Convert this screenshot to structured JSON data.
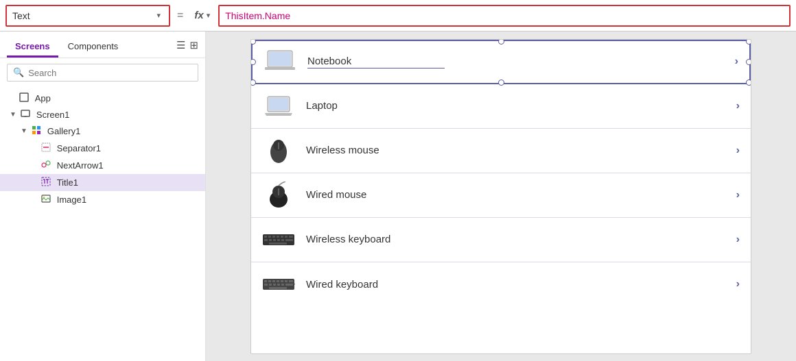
{
  "formulaBar": {
    "propertyLabel": "Text",
    "equalsSign": "=",
    "fxLabel": "fx",
    "expression": "ThisItem.Name",
    "expressionColored": "ThisItem.Name",
    "dropdownArrow": "▾",
    "dropdownArrow2": "▾"
  },
  "leftPanel": {
    "tabs": [
      {
        "id": "screens",
        "label": "Screens",
        "active": true
      },
      {
        "id": "components",
        "label": "Components",
        "active": false
      }
    ],
    "searchPlaceholder": "Search",
    "tree": [
      {
        "id": "app",
        "label": "App",
        "level": 0,
        "icon": "app",
        "expandable": false,
        "selected": false
      },
      {
        "id": "screen1",
        "label": "Screen1",
        "level": 0,
        "icon": "screen",
        "expandable": true,
        "expanded": true,
        "selected": false
      },
      {
        "id": "gallery1",
        "label": "Gallery1",
        "level": 1,
        "icon": "gallery",
        "expandable": true,
        "expanded": true,
        "selected": false
      },
      {
        "id": "separator1",
        "label": "Separator1",
        "level": 2,
        "icon": "separator",
        "expandable": false,
        "selected": false
      },
      {
        "id": "nextarrow1",
        "label": "NextArrow1",
        "level": 2,
        "icon": "nextarrow",
        "expandable": false,
        "selected": false
      },
      {
        "id": "title1",
        "label": "Title1",
        "level": 2,
        "icon": "title",
        "expandable": false,
        "selected": true
      },
      {
        "id": "image1",
        "label": "Image1",
        "level": 2,
        "icon": "image",
        "expandable": false,
        "selected": false
      }
    ]
  },
  "canvas": {
    "items": [
      {
        "id": "notebook",
        "label": "Notebook",
        "icon": "💻",
        "selected": true,
        "chevron": "›"
      },
      {
        "id": "laptop",
        "label": "Laptop",
        "icon": "💻",
        "selected": false,
        "chevron": "›"
      },
      {
        "id": "wireless-mouse",
        "label": "Wireless mouse",
        "icon": "🖱️",
        "selected": false,
        "chevron": "›"
      },
      {
        "id": "wired-mouse",
        "label": "Wired mouse",
        "icon": "🖱️",
        "selected": false,
        "chevron": "›"
      },
      {
        "id": "wireless-keyboard",
        "label": "Wireless keyboard",
        "icon": "⌨️",
        "selected": false,
        "chevron": "›"
      },
      {
        "id": "wired-keyboard",
        "label": "Wired keyboard",
        "icon": "⌨️",
        "selected": false,
        "chevron": "›"
      }
    ]
  }
}
